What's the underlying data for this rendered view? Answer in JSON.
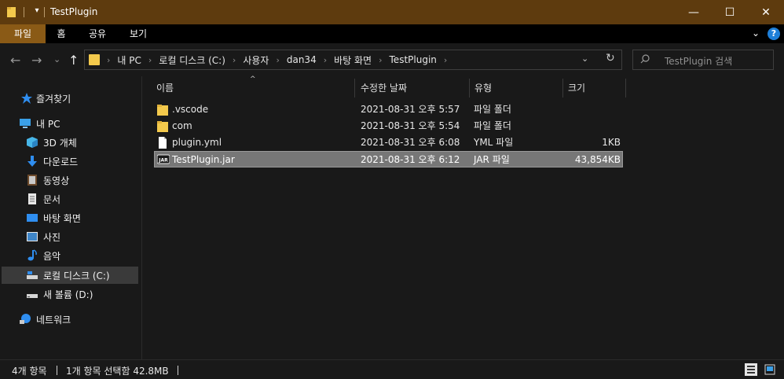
{
  "window": {
    "title": "TestPlugin",
    "minimize_glyph": "—",
    "maximize_glyph": "☐",
    "close_glyph": "✕",
    "quick_access_glyph": "▾"
  },
  "ribbon": {
    "tabs": [
      "파일",
      "홈",
      "공유",
      "보기"
    ],
    "active_tab": "파일",
    "expand_glyph": "⌄",
    "help_glyph": "?"
  },
  "nav": {
    "back_glyph": "←",
    "forward_glyph": "→",
    "recent_glyph": "⌄",
    "up_glyph": "↑",
    "breadcrumb": [
      "내 PC",
      "로컬 디스크 (C:)",
      "사용자",
      "dan34",
      "바탕 화면",
      "TestPlugin"
    ],
    "chevron_glyph": "›",
    "dropdown_glyph": "⌄",
    "refresh_glyph": "↻",
    "search_placeholder": "TestPlugin 검색"
  },
  "sidebar": {
    "items": [
      {
        "label": "즐겨찾기",
        "icon": "star-icon"
      },
      {
        "label": "내 PC",
        "icon": "pc-icon"
      },
      {
        "label": "3D 개체",
        "icon": "cube-icon"
      },
      {
        "label": "다운로드",
        "icon": "download-icon"
      },
      {
        "label": "동영상",
        "icon": "video-icon"
      },
      {
        "label": "문서",
        "icon": "document-icon"
      },
      {
        "label": "바탕 화면",
        "icon": "desktop-icon"
      },
      {
        "label": "사진",
        "icon": "picture-icon"
      },
      {
        "label": "음악",
        "icon": "music-icon"
      },
      {
        "label": "로컬 디스크 (C:)",
        "icon": "drive-icon"
      },
      {
        "label": "새 볼륨 (D:)",
        "icon": "drive-icon"
      },
      {
        "label": "네트워크",
        "icon": "network-icon"
      }
    ],
    "selected": "로컬 디스크 (C:)"
  },
  "table": {
    "sort_glyph": "^",
    "columns": [
      "이름",
      "수정한 날짜",
      "유형",
      "크기"
    ],
    "rows": [
      {
        "name": ".vscode",
        "date": "2021-08-31 오후 5:57",
        "type": "파일 폴더",
        "size": "",
        "icon": "folder-icon"
      },
      {
        "name": "com",
        "date": "2021-08-31 오후 5:54",
        "type": "파일 폴더",
        "size": "",
        "icon": "folder-icon"
      },
      {
        "name": "plugin.yml",
        "date": "2021-08-31 오후 6:08",
        "type": "YML 파일",
        "size": "1KB",
        "icon": "file-icon"
      },
      {
        "name": "TestPlugin.jar",
        "date": "2021-08-31 오후 6:12",
        "type": "JAR 파일",
        "size": "43,854KB",
        "icon": "jar-icon"
      }
    ],
    "selected_row": "TestPlugin.jar"
  },
  "status": {
    "count": "4개 항목",
    "selection": "1개 항목 선택함 42.8MB"
  },
  "colors": {
    "titlebar": "#5e3b0e",
    "ribbon_active": "#8a5a16",
    "background": "#191919",
    "selection": "#777777",
    "folder": "#f3c94c",
    "help": "#1e7fd8"
  }
}
